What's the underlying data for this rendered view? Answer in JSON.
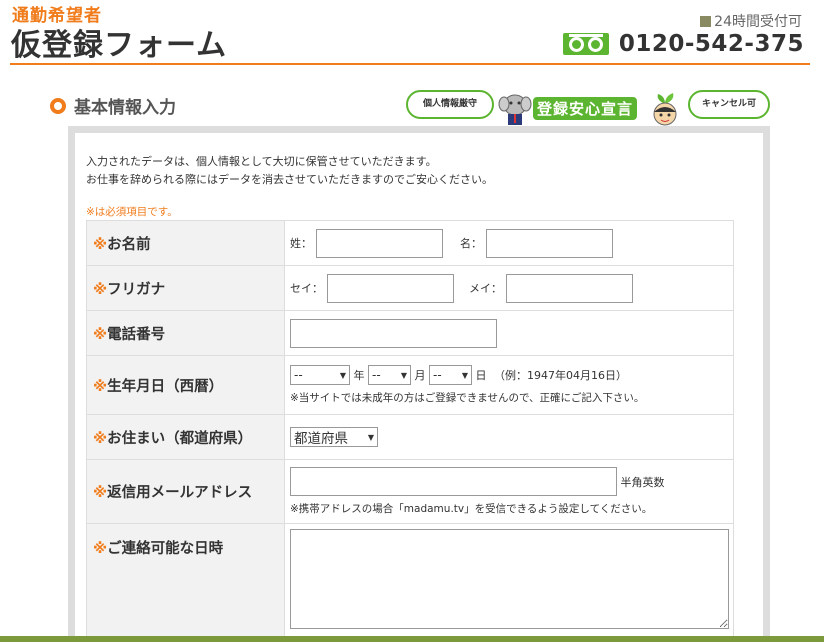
{
  "header": {
    "subtitle": "通勤希望者",
    "title": "仮登録フォーム",
    "hours": "24時間受付可",
    "phone": "0120-542-375"
  },
  "section": {
    "title": "基本情報入力"
  },
  "badges": {
    "privacy": "個人情報厳守",
    "declaration": "登録安心宣言",
    "cancel": "キャンセル可"
  },
  "intro": {
    "line1": "入力されたデータは、個人情報として大切に保管させていただきます。",
    "line2": "お仕事を辞められる際にはデータを消去させていただきますのでご安心ください。"
  },
  "required_note": "※は必須項目です。",
  "form": {
    "asterisk": "※",
    "name": {
      "label": "お名前",
      "sei": "姓：",
      "mei": "名："
    },
    "kana": {
      "label": "フリガナ",
      "sei": "セイ：",
      "mei": "メイ："
    },
    "phone": {
      "label": "電話番号"
    },
    "birth": {
      "label": "生年月日（西暦）",
      "year_value": "--",
      "year_unit": "年",
      "month_value": "--",
      "month_unit": "月",
      "day_value": "--",
      "day_unit": "日",
      "example": "（例：1947年04月16日）",
      "note": "※当サイトでは未成年の方はご登録できませんので、正確にご記入下さい。"
    },
    "address": {
      "label": "お住まい（都道府県）",
      "select_value": "都道府県"
    },
    "email": {
      "label": "返信用メールアドレス",
      "suffix": "半角英数",
      "note": "※携帯アドレスの場合「madamu.tv」を受信できるよう設定してください。"
    },
    "contact_time": {
      "label": "ご連絡可能な日時"
    }
  },
  "colors": {
    "accent": "#f07c1c",
    "green": "#5cb531"
  }
}
